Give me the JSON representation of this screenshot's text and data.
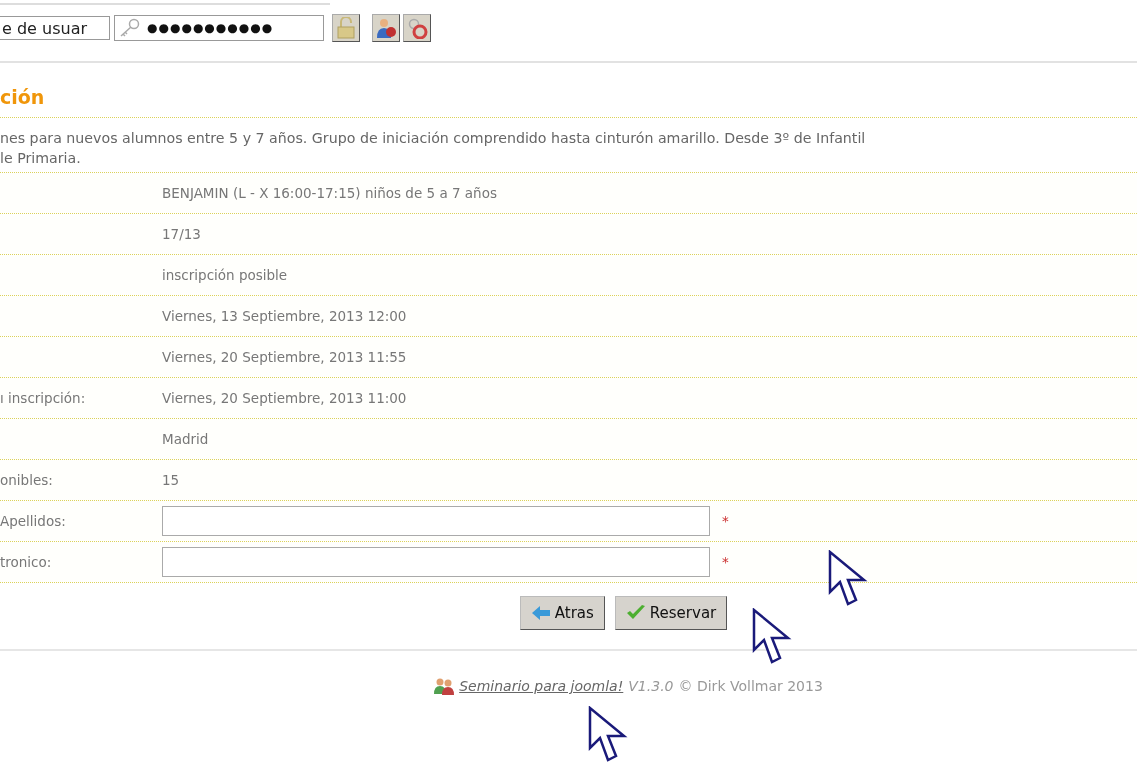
{
  "login": {
    "username": "e de usuar",
    "password": "●●●●●●●●●●●"
  },
  "heading": "ción",
  "description": [
    "nes para nuevos alumnos entre 5 y 7 años. Grupo de iniciación comprendido hasta cinturón amarillo. Desde 3º de Infantil",
    "le Primaria."
  ],
  "rows": [
    {
      "kind": "text",
      "value": "BENJAMIN (L - X 16:00-17:15) niños de 5 a 7 años"
    },
    {
      "kind": "text",
      "value": "17/13"
    },
    {
      "kind": "text",
      "value": "inscripción posible"
    },
    {
      "kind": "text",
      "value": "Viernes, 13 Septiembre, 2013 12:00"
    },
    {
      "kind": "text",
      "value": "Viernes, 20 Septiembre, 2013 11:55"
    },
    {
      "kind": "text",
      "label": "ı inscripción:",
      "value": "Viernes, 20 Septiembre, 2013 11:00"
    },
    {
      "kind": "text",
      "value": "Madrid"
    },
    {
      "kind": "text",
      "label": "onibles:",
      "value": "15"
    },
    {
      "kind": "input",
      "label": "Apellidos:",
      "required": "*"
    },
    {
      "kind": "input",
      "label": "tronico:",
      "required": "*"
    }
  ],
  "buttons": [
    {
      "kind": "back",
      "label": "Atras"
    },
    {
      "kind": "submit",
      "label": "Reservar"
    }
  ],
  "footer": {
    "link": "Seminario para joomla!",
    "version": "V1.3.0",
    "rest": "© Dirk Vollmar 2013"
  }
}
